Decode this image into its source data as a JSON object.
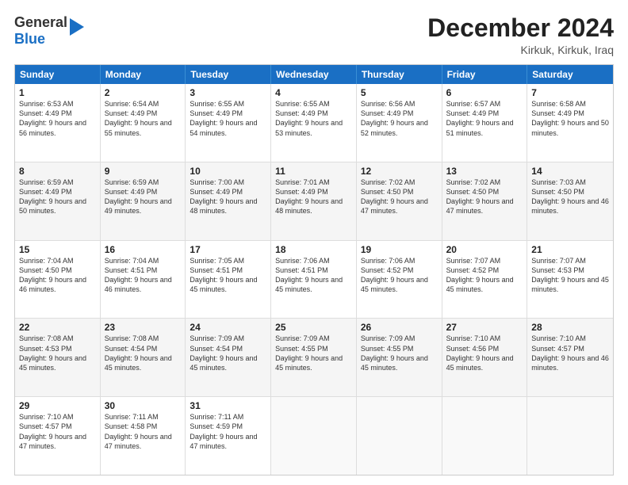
{
  "header": {
    "logo_line1": "General",
    "logo_line2": "Blue",
    "month_title": "December 2024",
    "location": "Kirkuk, Kirkuk, Iraq"
  },
  "weekdays": [
    "Sunday",
    "Monday",
    "Tuesday",
    "Wednesday",
    "Thursday",
    "Friday",
    "Saturday"
  ],
  "rows": [
    {
      "alt": false,
      "cells": [
        {
          "day": "1",
          "sunrise": "6:53 AM",
          "sunset": "4:49 PM",
          "daylight": "9 hours and 56 minutes."
        },
        {
          "day": "2",
          "sunrise": "6:54 AM",
          "sunset": "4:49 PM",
          "daylight": "9 hours and 55 minutes."
        },
        {
          "day": "3",
          "sunrise": "6:55 AM",
          "sunset": "4:49 PM",
          "daylight": "9 hours and 54 minutes."
        },
        {
          "day": "4",
          "sunrise": "6:55 AM",
          "sunset": "4:49 PM",
          "daylight": "9 hours and 53 minutes."
        },
        {
          "day": "5",
          "sunrise": "6:56 AM",
          "sunset": "4:49 PM",
          "daylight": "9 hours and 52 minutes."
        },
        {
          "day": "6",
          "sunrise": "6:57 AM",
          "sunset": "4:49 PM",
          "daylight": "9 hours and 51 minutes."
        },
        {
          "day": "7",
          "sunrise": "6:58 AM",
          "sunset": "4:49 PM",
          "daylight": "9 hours and 50 minutes."
        }
      ]
    },
    {
      "alt": true,
      "cells": [
        {
          "day": "8",
          "sunrise": "6:59 AM",
          "sunset": "4:49 PM",
          "daylight": "9 hours and 50 minutes."
        },
        {
          "day": "9",
          "sunrise": "6:59 AM",
          "sunset": "4:49 PM",
          "daylight": "9 hours and 49 minutes."
        },
        {
          "day": "10",
          "sunrise": "7:00 AM",
          "sunset": "4:49 PM",
          "daylight": "9 hours and 48 minutes."
        },
        {
          "day": "11",
          "sunrise": "7:01 AM",
          "sunset": "4:49 PM",
          "daylight": "9 hours and 48 minutes."
        },
        {
          "day": "12",
          "sunrise": "7:02 AM",
          "sunset": "4:50 PM",
          "daylight": "9 hours and 47 minutes."
        },
        {
          "day": "13",
          "sunrise": "7:02 AM",
          "sunset": "4:50 PM",
          "daylight": "9 hours and 47 minutes."
        },
        {
          "day": "14",
          "sunrise": "7:03 AM",
          "sunset": "4:50 PM",
          "daylight": "9 hours and 46 minutes."
        }
      ]
    },
    {
      "alt": false,
      "cells": [
        {
          "day": "15",
          "sunrise": "7:04 AM",
          "sunset": "4:50 PM",
          "daylight": "9 hours and 46 minutes."
        },
        {
          "day": "16",
          "sunrise": "7:04 AM",
          "sunset": "4:51 PM",
          "daylight": "9 hours and 46 minutes."
        },
        {
          "day": "17",
          "sunrise": "7:05 AM",
          "sunset": "4:51 PM",
          "daylight": "9 hours and 45 minutes."
        },
        {
          "day": "18",
          "sunrise": "7:06 AM",
          "sunset": "4:51 PM",
          "daylight": "9 hours and 45 minutes."
        },
        {
          "day": "19",
          "sunrise": "7:06 AM",
          "sunset": "4:52 PM",
          "daylight": "9 hours and 45 minutes."
        },
        {
          "day": "20",
          "sunrise": "7:07 AM",
          "sunset": "4:52 PM",
          "daylight": "9 hours and 45 minutes."
        },
        {
          "day": "21",
          "sunrise": "7:07 AM",
          "sunset": "4:53 PM",
          "daylight": "9 hours and 45 minutes."
        }
      ]
    },
    {
      "alt": true,
      "cells": [
        {
          "day": "22",
          "sunrise": "7:08 AM",
          "sunset": "4:53 PM",
          "daylight": "9 hours and 45 minutes."
        },
        {
          "day": "23",
          "sunrise": "7:08 AM",
          "sunset": "4:54 PM",
          "daylight": "9 hours and 45 minutes."
        },
        {
          "day": "24",
          "sunrise": "7:09 AM",
          "sunset": "4:54 PM",
          "daylight": "9 hours and 45 minutes."
        },
        {
          "day": "25",
          "sunrise": "7:09 AM",
          "sunset": "4:55 PM",
          "daylight": "9 hours and 45 minutes."
        },
        {
          "day": "26",
          "sunrise": "7:09 AM",
          "sunset": "4:55 PM",
          "daylight": "9 hours and 45 minutes."
        },
        {
          "day": "27",
          "sunrise": "7:10 AM",
          "sunset": "4:56 PM",
          "daylight": "9 hours and 45 minutes."
        },
        {
          "day": "28",
          "sunrise": "7:10 AM",
          "sunset": "4:57 PM",
          "daylight": "9 hours and 46 minutes."
        }
      ]
    },
    {
      "alt": false,
      "cells": [
        {
          "day": "29",
          "sunrise": "7:10 AM",
          "sunset": "4:57 PM",
          "daylight": "9 hours and 47 minutes."
        },
        {
          "day": "30",
          "sunrise": "7:11 AM",
          "sunset": "4:58 PM",
          "daylight": "9 hours and 47 minutes."
        },
        {
          "day": "31",
          "sunrise": "7:11 AM",
          "sunset": "4:59 PM",
          "daylight": "9 hours and 47 minutes."
        },
        null,
        null,
        null,
        null
      ]
    }
  ],
  "labels": {
    "sunrise": "Sunrise:",
    "sunset": "Sunset:",
    "daylight": "Daylight:"
  }
}
